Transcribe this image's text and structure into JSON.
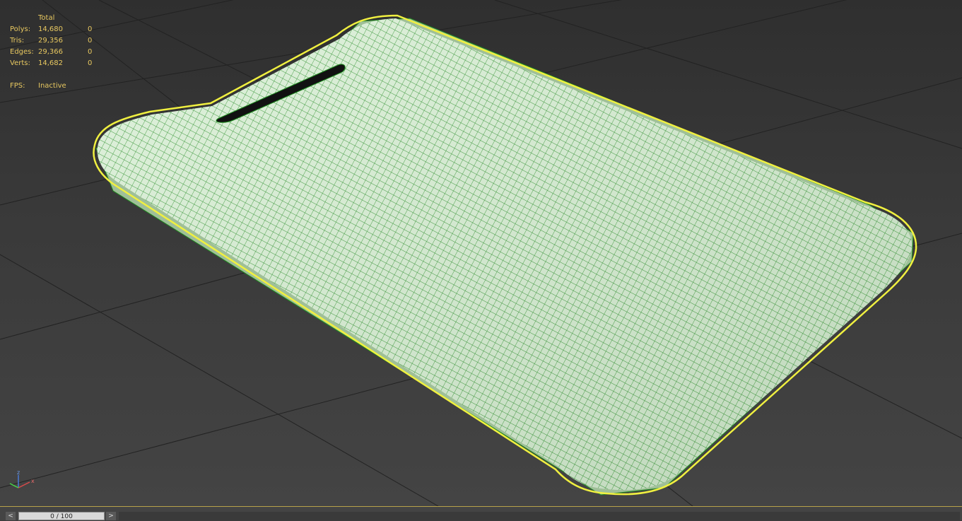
{
  "stats": {
    "header": "Total",
    "rows": [
      {
        "label": "Polys:",
        "total": "14,680",
        "selected": "0"
      },
      {
        "label": "Tris:",
        "total": "29,356",
        "selected": "0"
      },
      {
        "label": "Edges:",
        "total": "29,366",
        "selected": "0"
      },
      {
        "label": "Verts:",
        "total": "14,682",
        "selected": "0"
      }
    ],
    "fps_label": "FPS:",
    "fps_value": "Inactive"
  },
  "timeline": {
    "frame_label": "0 / 100",
    "prev_label": "<",
    "next_label": ">"
  },
  "gizmo": {
    "z_label": "z",
    "x_label": "x"
  },
  "colors": {
    "stats_text": "#e8c860",
    "wire": "#1e8a1e",
    "selection_outline": "#f0f040",
    "surface": "#d6ecd2"
  }
}
